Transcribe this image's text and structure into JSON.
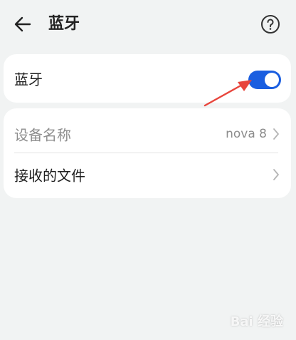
{
  "header": {
    "title": "蓝牙",
    "back_icon": "back-arrow-icon",
    "help_icon": "help-icon"
  },
  "bluetooth_card": {
    "label": "蓝牙",
    "toggle_on": true,
    "accent_color": "#1a5ee0"
  },
  "list_card": {
    "items": [
      {
        "label": "设备名称",
        "value": "nova 8",
        "muted": true
      },
      {
        "label": "接收的文件",
        "value": ""
      }
    ]
  },
  "annotation": {
    "arrow_color": "#e8453c"
  },
  "watermark": {
    "text": "Bai 经验"
  }
}
